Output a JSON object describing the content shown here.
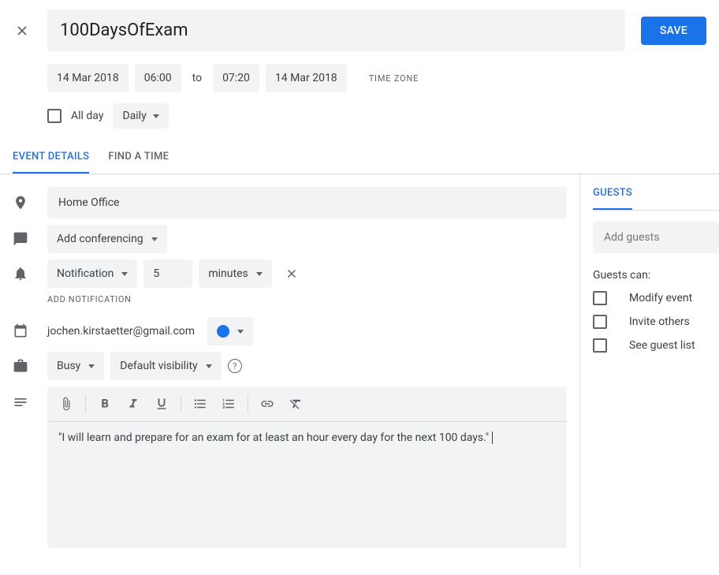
{
  "header": {
    "title": "100DaysOfExam",
    "save_label": "SAVE"
  },
  "dates": {
    "start_date": "14 Mar 2018",
    "start_time": "06:00",
    "to_label": "to",
    "end_time": "07:20",
    "end_date": "14 Mar 2018",
    "timezone_label": "TIME ZONE"
  },
  "allday": {
    "label": "All day",
    "repeat": "Daily"
  },
  "tabs": {
    "event_details": "EVENT DETAILS",
    "find_time": "FIND A TIME"
  },
  "location": {
    "value": "Home Office"
  },
  "conferencing": {
    "label": "Add conferencing"
  },
  "notification": {
    "type": "Notification",
    "value": "5",
    "unit": "minutes",
    "add_label": "ADD NOTIFICATION"
  },
  "calendar": {
    "email": "jochen.kirstaetter@gmail.com"
  },
  "availability": {
    "busy": "Busy",
    "visibility": "Default visibility"
  },
  "description": {
    "text": "\"I will learn and prepare for an exam for at least an hour every day for the next 100 days.\""
  },
  "guests": {
    "tab_label": "GUESTS",
    "placeholder": "Add guests",
    "can_label": "Guests can:",
    "permissions": [
      "Modify event",
      "Invite others",
      "See guest list"
    ]
  }
}
